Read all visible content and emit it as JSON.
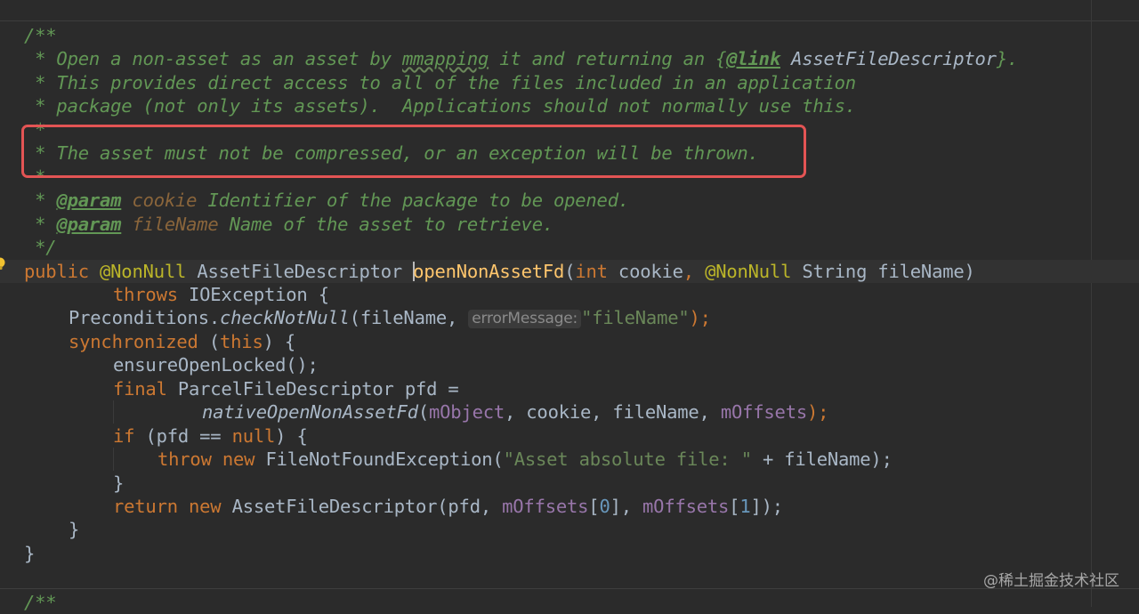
{
  "doc": {
    "l1": "/**",
    "l2_pre": " * Open a non-asset as an asset by ",
    "l2_sq": "mmapping",
    "l2_mid": " it and returning an {",
    "l2_link": "@link",
    "l2_ref": " AssetFileDescriptor",
    "l2_end": "}.",
    "l3": " * This provides direct access to all of the files included in an application",
    "l4": " * package (not only its assets).  Applications should not normally use this.",
    "l5": " *",
    "l6": " * The asset must not be compressed, or an exception will be thrown.",
    "l7": " *",
    "l8_star": " * ",
    "l8_tag": "@param",
    "l8_name": " cookie",
    "l8_desc": " Identifier of the package to be opened.",
    "l9_star": " * ",
    "l9_tag": "@param",
    "l9_name": " fileName",
    "l9_desc": " Name of the asset to retrieve.",
    "l10": " */"
  },
  "code": {
    "sig_public": "public",
    "sig_ann1": "@NonNull",
    "sig_type": "AssetFileDescriptor",
    "sig_caret_char": "o",
    "sig_name_rest": "penNonAssetFd",
    "sig_paren": "(",
    "sig_int": "int",
    "sig_cookie": " cookie",
    "sig_comma": ", ",
    "sig_ann2": "@NonNull",
    "sig_rest": " String fileName)",
    "throws_kw": "throws",
    "throws_rest": " IOException {",
    "pre_obj": "Preconditions.",
    "pre_method": "checkNotNull",
    "pre_arg": "(fileName, ",
    "pre_hint": "errorMessage:",
    "pre_str": "\"fileName\"",
    "pre_end": ");",
    "sync_kw": "synchronized",
    "sync_open": " (",
    "sync_this": "this",
    "sync_close": ") {",
    "ensure": "ensureOpenLocked();",
    "final_kw": "final",
    "final_rest": " ParcelFileDescriptor pfd =",
    "native_method": "nativeOpenNonAssetFd",
    "native_open": "(",
    "native_mobj": "mObject",
    "native_mid": ", cookie, fileName, ",
    "native_moff": "mOffsets",
    "native_end": ");",
    "if_kw": "if",
    "if_mid": " (pfd == ",
    "if_null": "null",
    "if_end": ") {",
    "throw_kw": "throw",
    "throw_new": " new",
    "throw_cls": " FileNotFoundException(",
    "throw_str": "\"Asset absolute file: \"",
    "throw_end": " + fileName);",
    "brace_close_if": "}",
    "ret_kw": "return",
    "ret_new": " new",
    "ret_cls": " AssetFileDescriptor(pfd, ",
    "ret_mo1": "mOffsets",
    "ret_i0_open": "[",
    "ret_i0": "0",
    "ret_i0_close": "], ",
    "ret_mo2": "mOffsets",
    "ret_i1_open": "[",
    "ret_i1": "1",
    "ret_i1_close": "]);",
    "brace_close_sync": "}",
    "brace_close_method": "}",
    "next_doc": "/**"
  },
  "watermark": "@稀土掘金技术社区",
  "colors": {
    "background": "#2b2b2b",
    "doc_comment": "#629755",
    "keyword": "#cc7832",
    "annotation": "#bbb529",
    "method_decl": "#ffc66d",
    "field": "#9876aa",
    "string": "#6a8759",
    "number": "#6897bb",
    "highlight_box": "#e35454"
  },
  "icons": [
    "intention-bulb-icon"
  ]
}
